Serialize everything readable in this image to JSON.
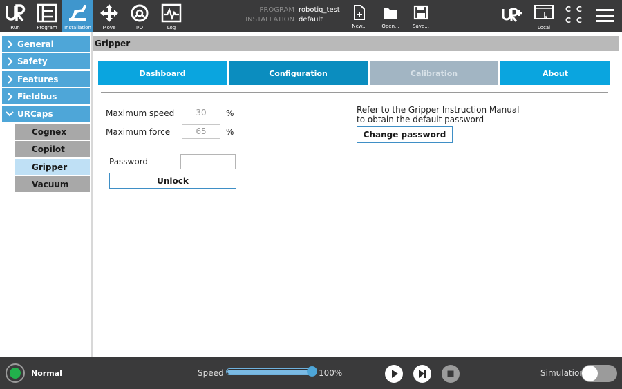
{
  "nav": {
    "items": [
      {
        "label": "Run",
        "icon": "ur-logo-icon"
      },
      {
        "label": "Program",
        "icon": "program-icon"
      },
      {
        "label": "Installation",
        "icon": "installation-icon"
      },
      {
        "label": "Move",
        "icon": "move-icon"
      },
      {
        "label": "I/O",
        "icon": "io-icon"
      },
      {
        "label": "Log",
        "icon": "log-icon"
      }
    ],
    "active": "Installation"
  },
  "program_info": {
    "program_key": "PROGRAM",
    "program_value": "robotiq_test",
    "installation_key": "INSTALLATION",
    "installation_value": "default"
  },
  "file_actions": {
    "new_label": "New...",
    "open_label": "Open...",
    "save_label": "Save..."
  },
  "topright": {
    "local_label": "Local",
    "cc_text": "C C"
  },
  "sidebar": {
    "items": [
      {
        "label": "General"
      },
      {
        "label": "Safety"
      },
      {
        "label": "Features"
      },
      {
        "label": "Fieldbus"
      },
      {
        "label": "URCaps"
      }
    ],
    "sub_items": [
      {
        "label": "Cognex"
      },
      {
        "label": "Copilot"
      },
      {
        "label": "Gripper"
      },
      {
        "label": "Vacuum"
      }
    ],
    "active_sub": "Gripper"
  },
  "main": {
    "title": "Gripper",
    "tabs": [
      {
        "label": "Dashboard",
        "state": "normal"
      },
      {
        "label": "Configuration",
        "state": "selected"
      },
      {
        "label": "Calibration",
        "state": "disabled"
      },
      {
        "label": "About",
        "state": "normal"
      }
    ],
    "max_speed_label": "Maximum speed",
    "max_speed_value": "30",
    "max_force_label": "Maximum force",
    "max_force_value": "65",
    "unit_percent": "%",
    "password_label": "Password",
    "password_value": "",
    "unlock_label": "Unlock",
    "manual_note_line1": "Refer to the Gripper Instruction Manual",
    "manual_note_line2": "to obtain the default password",
    "change_password_label": "Change password"
  },
  "status": {
    "mode": "Normal",
    "speed_label": "Speed",
    "speed_value": "100%",
    "speed_fraction": 1.0,
    "simulation_label": "Simulation",
    "simulation_on": false
  },
  "colors": {
    "accent": "#3f96cd",
    "tab_normal": "#0aa5df",
    "tab_selected": "#0b8dbf",
    "tab_disabled": "#a2b5c3",
    "sidebar": "#4ea6d8",
    "status_ok": "#22b14c"
  }
}
